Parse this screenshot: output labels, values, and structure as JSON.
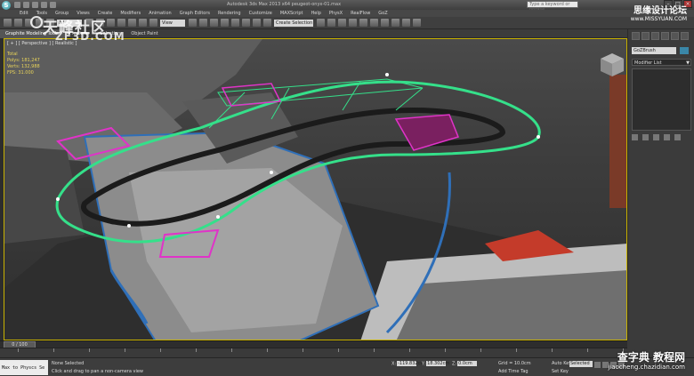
{
  "titlebar": {
    "logo_letter": "S",
    "title": "Autodesk 3ds Max 2013 x64    peugeot-onyx-01.max",
    "search_placeholder": "Type a keyword or phrase"
  },
  "menu": [
    "Edit",
    "Tools",
    "Group",
    "Views",
    "Create",
    "Modifiers",
    "Animation",
    "Graph Editors",
    "Rendering",
    "Customize",
    "MAXScript",
    "Help",
    "PhysX",
    "RealFlow",
    "GoZ"
  ],
  "toolbar": {
    "selection_set": "All",
    "view_dropdown": "View",
    "named_selection": "Create Selection Se"
  },
  "ribbon": {
    "tabs": [
      "Graphite Modeling Tools",
      "Freeform",
      "Selection",
      "Object Paint"
    ]
  },
  "viewport": {
    "label": "[ + ] [ Perspective ] [ Realistic ]",
    "stats": {
      "total_label": "Total",
      "polys_label": "Polys:",
      "polys": "181,247",
      "verts_label": "Verts:",
      "verts": "132,988",
      "fps_label": "FPS:",
      "fps": "31.000"
    }
  },
  "watermarks": {
    "left_main": "天峰社区",
    "left_sub": "ZF3D.COM",
    "right_main": "思缘设计论坛",
    "right_url": "www.MISSYUAN.COM",
    "bottom_main": "查字典 教程网",
    "bottom_url": "jiaocheng.chazidian.com"
  },
  "command_panel": {
    "object_name": "GoZBrush",
    "modifier_list": "Modifier List",
    "swatch_color": "#3a87a8"
  },
  "timeline": {
    "frame": "0 / 100"
  },
  "status": {
    "listener": "Max to Physcs Se",
    "selected": "None Selected",
    "prompt": "Click and drag to pan a non-camera view",
    "x_label": "X:",
    "x_value": "-119.832cm",
    "y_label": "Y:",
    "y_value": "18.302cm",
    "z_label": "Z:",
    "z_value": "0.0cm",
    "grid": "Grid = 10.0cm",
    "add_time_tag": "Add Time Tag",
    "auto_key": "Auto Key",
    "set_key": "Set Key",
    "selected_dropdown": "Selected"
  }
}
